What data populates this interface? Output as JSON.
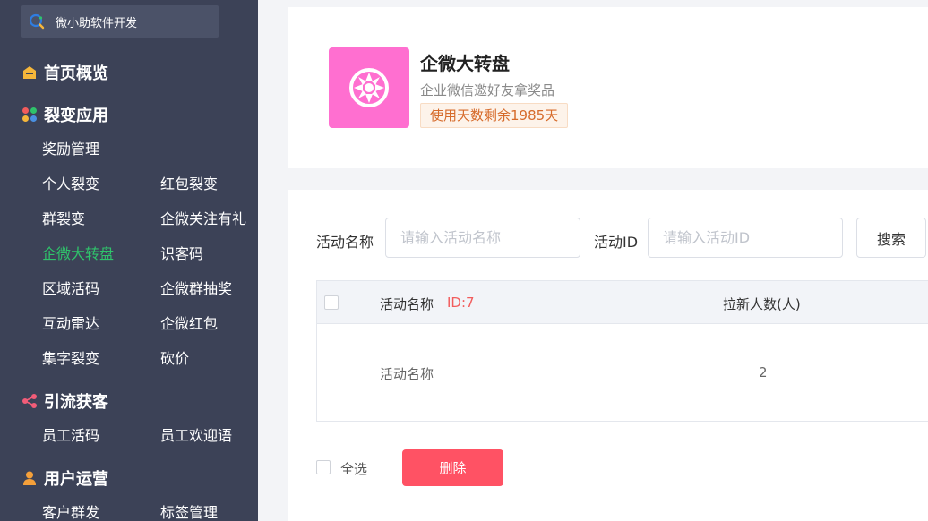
{
  "brand": {
    "name": "微小助软件开发",
    "icon": "search-magnifier-icon"
  },
  "sidebar": {
    "groups": [
      {
        "title": "首页概览",
        "icon": "home-icon",
        "color": "#f5b63a"
      },
      {
        "title": "裂变应用",
        "icon": "apps-grid-icon",
        "color": "#4a90e2"
      },
      {
        "title": "引流获客",
        "icon": "share-icon",
        "color": "#f25c78"
      },
      {
        "title": "用户运营",
        "icon": "user-icon",
        "color": "#f5a03a"
      }
    ],
    "items": {
      "reward": "奖励管理",
      "personal": "个人裂变",
      "redpack": "红包裂变",
      "group": "群裂变",
      "follow": "企微关注有礼",
      "wheel": "企微大转盘",
      "code": "识客码",
      "region": "区域活码",
      "group_lottery": "企微群抽奖",
      "radar": "互动雷达",
      "wecom_redpack": "企微红包",
      "collect": "集字裂变",
      "bargain": "砍价",
      "staff_code": "员工活码",
      "welcome": "员工欢迎语",
      "cust_group": "客户群发",
      "tags": "标签管理"
    },
    "active_color": "#2fc36b"
  },
  "app": {
    "title": "企微大转盘",
    "subtitle": "企业微信邀好友拿奖品",
    "days_left": "使用天数剩余1985天",
    "logo_color": "#ff6fd0"
  },
  "filters": {
    "name_label": "活动名称",
    "name_placeholder": "请输入活动名称",
    "id_label": "活动ID",
    "id_placeholder": "请输入活动ID",
    "search_label": "搜索"
  },
  "table": {
    "headers": {
      "name": "活动名称",
      "id": "ID:7",
      "count": "拉新人数(人)"
    },
    "rows": [
      {
        "name": "活动名称",
        "count": "2"
      }
    ]
  },
  "footer": {
    "select_all": "全选",
    "delete_label": "删除",
    "delete_color": "#ff5264"
  }
}
